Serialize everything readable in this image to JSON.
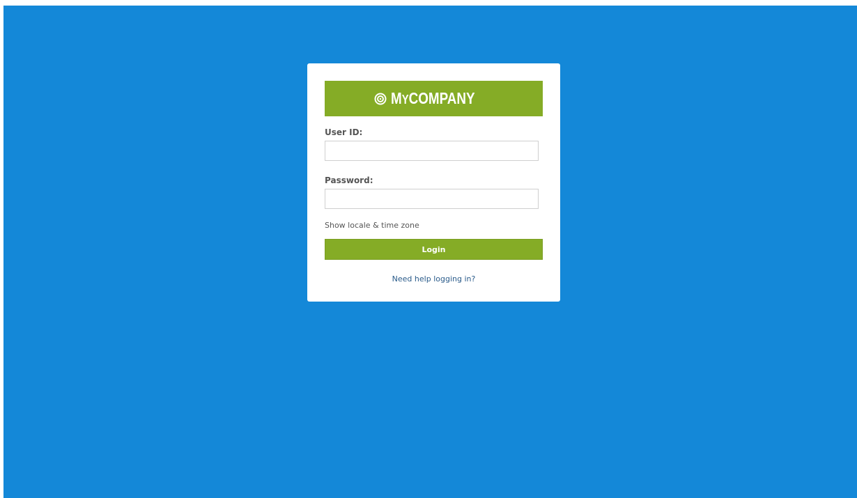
{
  "login": {
    "logo": {
      "prefix": "M",
      "prefix_small": "Y",
      "name": "COMPANY",
      "brand_color": "#85ac26",
      "icon": "target-icon"
    },
    "user_id_label": "User ID:",
    "user_id_value": "",
    "password_label": "Password:",
    "password_value": "",
    "locale_link": "Show locale & time zone",
    "login_button": "Login",
    "help_link": "Need help logging in?"
  },
  "colors": {
    "background": "#1488d8",
    "card": "#ffffff",
    "accent": "#85ac26",
    "link": "#2a5b8a"
  }
}
